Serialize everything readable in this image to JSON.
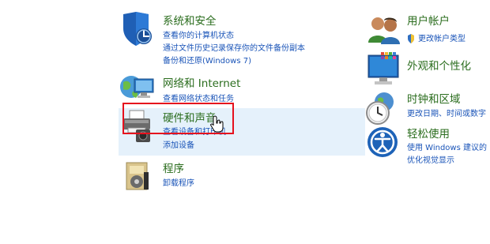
{
  "left": {
    "system": {
      "title": "系统和安全",
      "links": [
        "查看你的计算机状态",
        "通过文件历史记录保存你的文件备份副本",
        "备份和还原(Windows 7)"
      ]
    },
    "network": {
      "title": "网络和 Internet",
      "links": [
        "查看网络状态和任务"
      ]
    },
    "hardware": {
      "title": "硬件和声音",
      "links": [
        "查看设备和打印机",
        "添加设备"
      ]
    },
    "programs": {
      "title": "程序",
      "links": [
        "卸载程序"
      ]
    }
  },
  "right": {
    "accounts": {
      "title": "用户帐户",
      "links": [
        "更改帐户类型"
      ]
    },
    "appearance": {
      "title": "外观和个性化",
      "links": []
    },
    "clock": {
      "title": "时钟和区域",
      "links": [
        "更改日期、时间或数字"
      ]
    },
    "ease": {
      "title": "轻松使用",
      "links": [
        "使用 Windows 建议的",
        "优化视觉显示"
      ]
    }
  },
  "colors": {
    "title_green": "#2b6d1e",
    "link_blue": "#1a54b8",
    "hover_bg": "#e5f1fb",
    "highlight_red": "#e5111d"
  }
}
